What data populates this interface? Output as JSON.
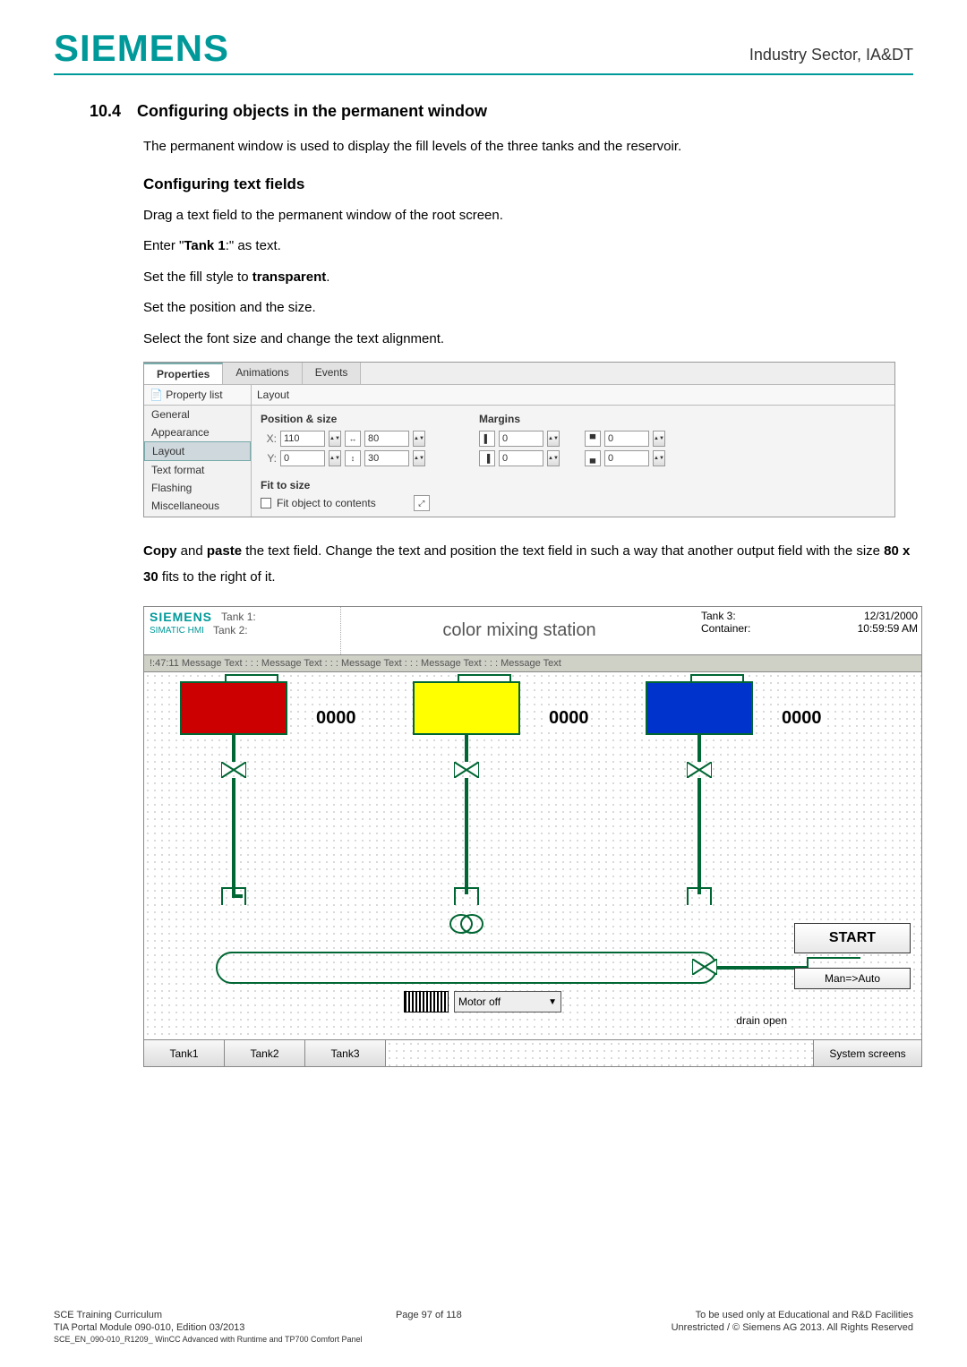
{
  "header": {
    "logo": "SIEMENS",
    "right": "Industry Sector, IA&DT"
  },
  "section": {
    "number": "10.4",
    "title": "Configuring objects in the permanent window"
  },
  "intro": "The permanent window is used to display the fill levels of the three tanks and the reservoir.",
  "sub1": "Configuring text fields",
  "steps": {
    "s1a": "Drag a text field to the permanent window of the root screen.",
    "s2a": "Enter \"",
    "s2b": "Tank 1",
    "s2c": ":\" as text.",
    "s3a": "Set the fill style to ",
    "s3b": "transparent",
    "s3c": ".",
    "s4": "Set the position and the size.",
    "s5": "Select the font size and change the text alignment."
  },
  "props": {
    "tabs": {
      "t1": "Properties",
      "t2": "Animations",
      "t3": "Events"
    },
    "side_top": "Property list",
    "side_items": [
      "General",
      "Appearance",
      "Layout",
      "Text format",
      "Flashing",
      "Miscellaneous"
    ],
    "layout_label": "Layout",
    "group_pos": "Position & size",
    "group_margins": "Margins",
    "x_label": "X:",
    "y_label": "Y:",
    "x_val": "110",
    "y_val": "0",
    "w_val": "80",
    "h_val": "30",
    "m1": "0",
    "m2": "0",
    "m3": "0",
    "m4": "0",
    "fit_title": "Fit to size",
    "fit_label": "Fit object to contents"
  },
  "para2a": "Copy",
  "para2b": " and ",
  "para2c": "paste",
  "para2d": " the text field. Change the text and position the text field in such a way that another output field with the size ",
  "para2e": "80 x 30",
  "para2f": " fits to the right of it.",
  "hmi": {
    "logo": "SIEMENS",
    "simatic": "SIMATIC HMI",
    "tank1": "Tank 1:",
    "tank2": "Tank 2:",
    "title": "color mixing station",
    "tank3": "Tank 3:",
    "container": "Container:",
    "date": "12/31/2000",
    "time": "10:59:59 AM",
    "msgbar": "!:47:11 Message Text : : : Message Text : : : Message Text : : : Message Text : : : Message Text",
    "val": "0000",
    "motor": "Motor off",
    "start": "START",
    "man": "Man=>Auto",
    "drain": "drain open",
    "btns": [
      "Tank1",
      "Tank2",
      "Tank3"
    ],
    "sys": "System screens"
  },
  "footer": {
    "l1": "SCE Training Curriculum",
    "c1": "Page 97 of 118",
    "r1": "To be used only at Educational and R&D Facilities",
    "l2": "TIA Portal Module 090-010, Edition 03/2013",
    "r2": "Unrestricted / © Siemens AG 2013. All Rights Reserved",
    "l3": "SCE_EN_090-010_R1209_ WinCC Advanced with Runtime and TP700 Comfort Panel"
  }
}
